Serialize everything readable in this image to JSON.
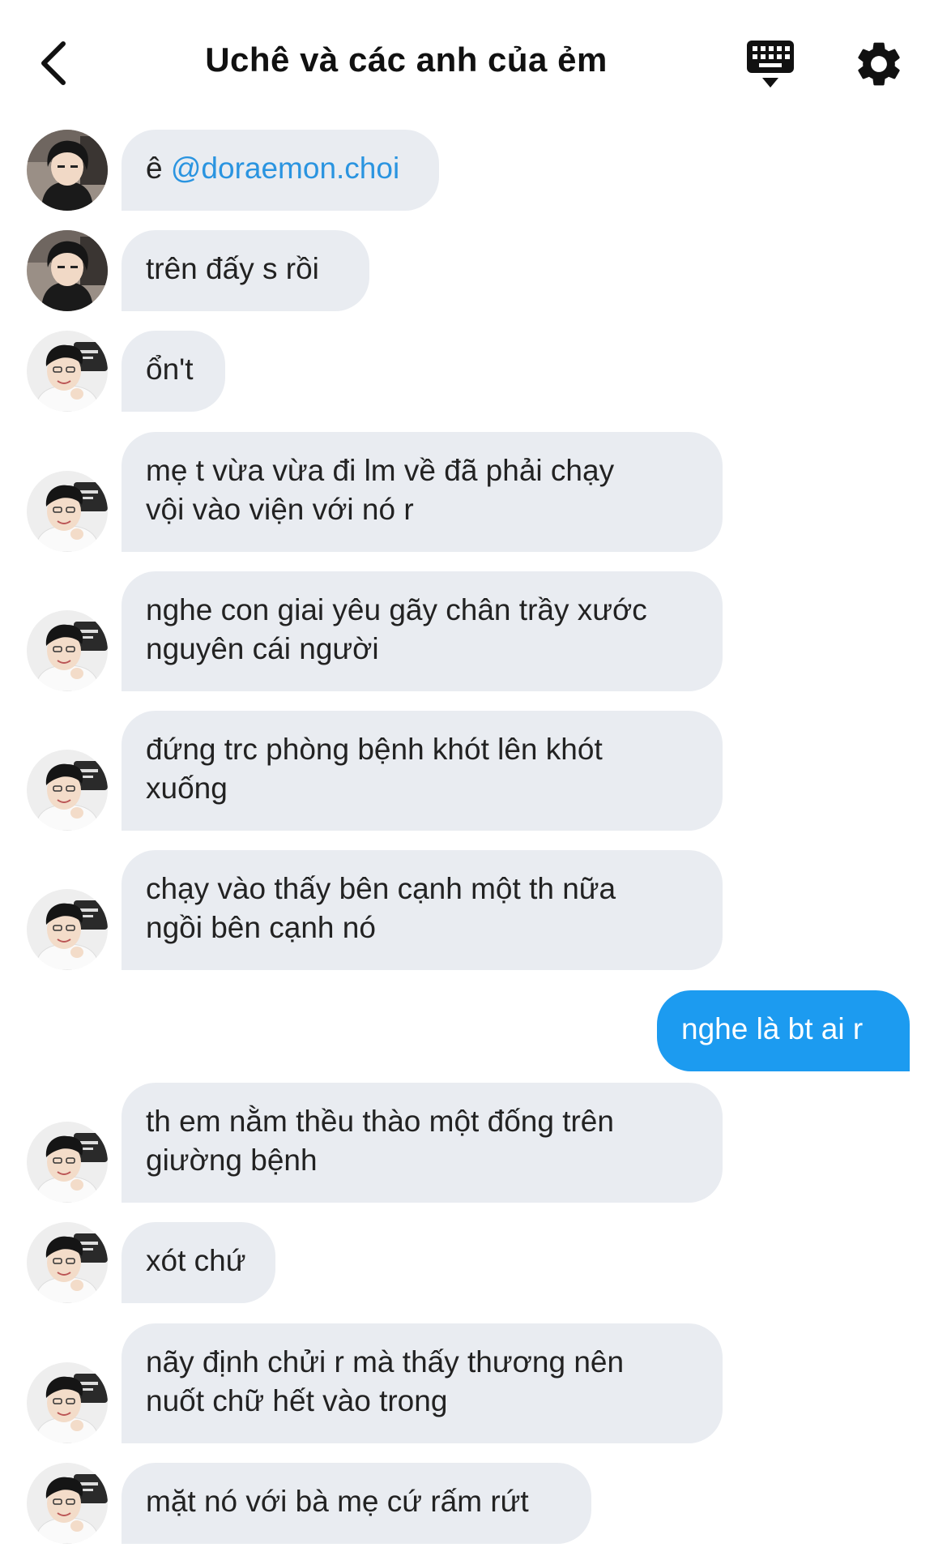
{
  "header": {
    "title": "Uchê và các anh của ẻm"
  },
  "icons": {
    "back": "chevron-left-icon",
    "keyboard": "keyboard-icon",
    "settings": "gear-icon"
  },
  "colors": {
    "bubble_in": "#e9ecf1",
    "bubble_out": "#1c9bf0",
    "mention": "#2a94e0"
  },
  "messages": [
    {
      "sender": "A",
      "prefix": "ê ",
      "mention": "@doraemon.choi"
    },
    {
      "sender": "A",
      "text": "trên đấy s rồi"
    },
    {
      "sender": "B",
      "text": "ổn't"
    },
    {
      "sender": "B",
      "text": "mẹ t vừa vừa đi lm về đã phải chạy\nvội vào viện với nó r"
    },
    {
      "sender": "B",
      "text": "nghe con giai yêu gãy chân trầy xước\nnguyên cái người"
    },
    {
      "sender": "B",
      "text": "đứng trc phòng bệnh khót lên khót\nxuống"
    },
    {
      "sender": "B",
      "text": "chạy vào thấy bên cạnh một th nữa\nngồi bên cạnh nó"
    },
    {
      "sender": "me",
      "text": "nghe là bt ai r"
    },
    {
      "sender": "B",
      "text": "th em nằm thều thào một đống trên\ngiường bệnh"
    },
    {
      "sender": "B",
      "text": "xót chứ"
    },
    {
      "sender": "B",
      "text": "nãy định chửi r mà thấy thương nên\nnuốt chữ hết vào trong"
    },
    {
      "sender": "B",
      "text": "mặt nó với bà mẹ cứ rấm rứt"
    }
  ]
}
